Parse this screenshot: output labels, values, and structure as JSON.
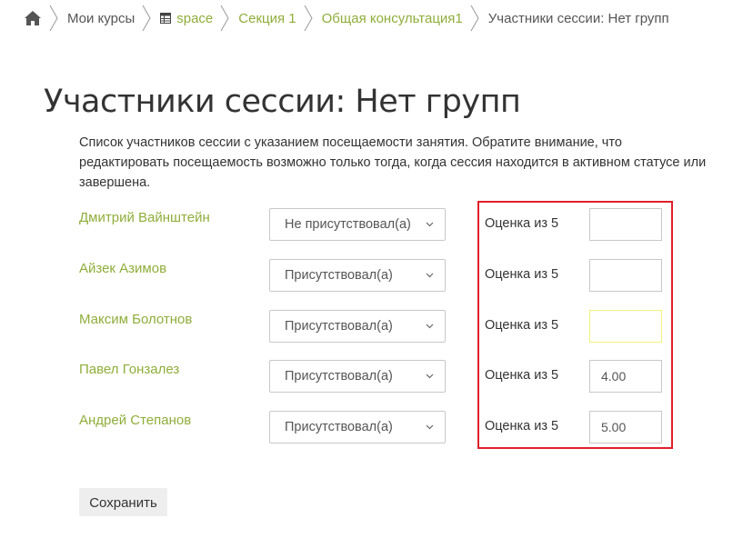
{
  "breadcrumb": {
    "home_icon": "home-icon",
    "items": [
      {
        "label": "Мои курсы",
        "link": false
      },
      {
        "label": "space",
        "link": true,
        "icon": "table-icon"
      },
      {
        "label": "Секция 1",
        "link": true
      },
      {
        "label": "Общая консультация1",
        "link": true
      },
      {
        "label": "Участники сессии: Нет групп",
        "link": false
      }
    ]
  },
  "page": {
    "title": "Участники сессии: Нет групп",
    "intro_line1": "Список участников сессии с указанием посещаемости занятия. Обратите внимание, что",
    "intro_line2": "редактировать посещаемость возможно только тогда, когда сессия находится в активном статусе или",
    "intro_line3": "завершена."
  },
  "participants": [
    {
      "name": "Дмитрий Вайнштейн",
      "attendance": "Не присутствовал(а)",
      "grade_label": "Оценка из 5",
      "grade": ""
    },
    {
      "name": "Айзек Азимов",
      "attendance": "Присутствовал(а)",
      "grade_label": "Оценка из 5",
      "grade": ""
    },
    {
      "name": "Максим Болотнов",
      "attendance": "Присутствовал(а)",
      "grade_label": "Оценка из 5",
      "grade": ""
    },
    {
      "name": "Павел Гонзалез",
      "attendance": "Присутствовал(а)",
      "grade_label": "Оценка из 5",
      "grade": "4.00"
    },
    {
      "name": "Андрей Степанов",
      "attendance": "Присутствовал(а)",
      "grade_label": "Оценка из 5",
      "grade": "5.00"
    }
  ],
  "actions": {
    "save_label": "Сохранить"
  },
  "colors": {
    "link": "#8fae3a",
    "highlight": "#e0202a",
    "focus": "#f2f27a"
  }
}
